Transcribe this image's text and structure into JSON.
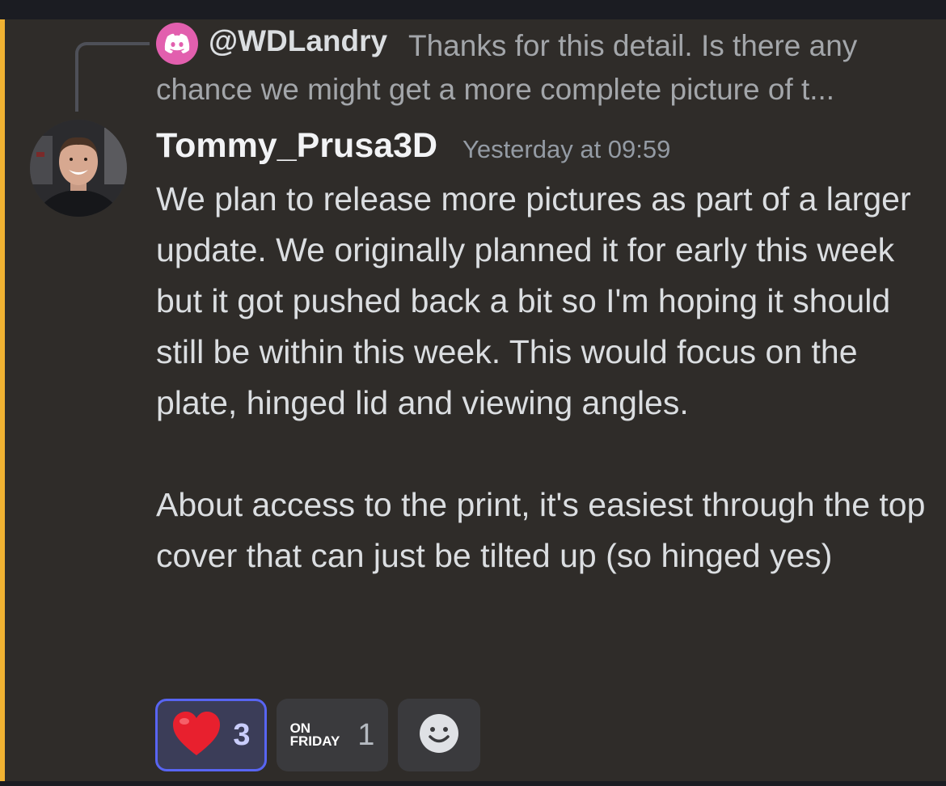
{
  "reply": {
    "username": "@WDLandry",
    "text": "Thanks for this detail. Is there any chance we might get a more complete picture of t..."
  },
  "message": {
    "author": "Tommy_Prusa3D",
    "timestamp": "Yesterday at 09:59",
    "paragraphs": [
      "We plan to release more pictures as part of a larger update. We originally planned it for early this week but it got pushed back a bit so I'm hoping it should still be within this week. This would focus on the plate, hinged lid and viewing angles.",
      "About access to the print, it's easiest through the top cover that can just be tilted up (so hinged yes)"
    ]
  },
  "reactions": [
    {
      "emoji": "heart-emoji",
      "count": "3",
      "selected": true
    },
    {
      "emoji_line1": "ON",
      "emoji_line2": "FRIDAY",
      "count": "1",
      "selected": false
    }
  ],
  "colors": {
    "accent": "#5865f2",
    "highlight_bar": "#f0b232",
    "discord_badge": "#e25fae"
  }
}
